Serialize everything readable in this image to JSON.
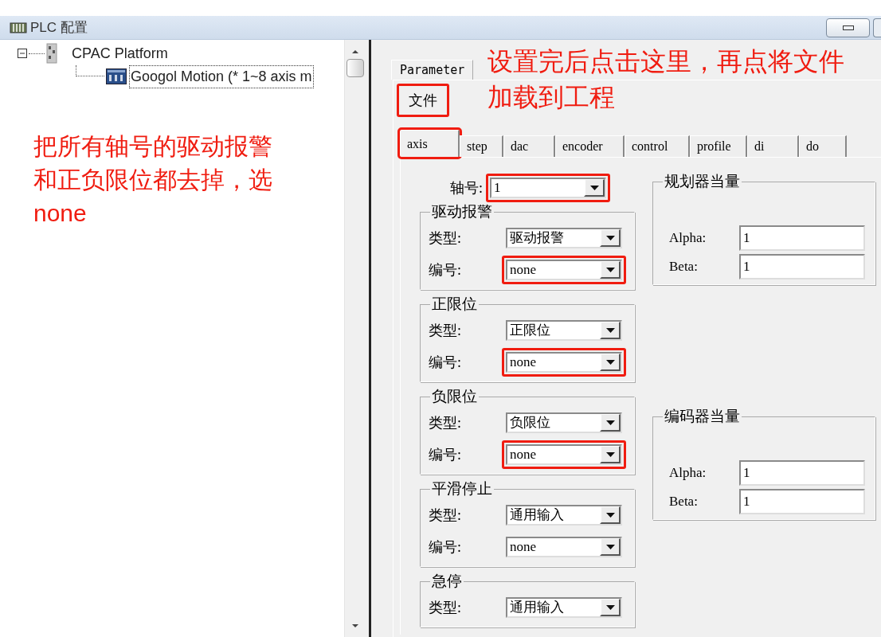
{
  "window": {
    "title": "PLC 配置"
  },
  "tree": [
    {
      "label": "CPAC Platform",
      "expanded": true,
      "children": [
        {
          "label": "Googol Motion (* 1~8 axis m",
          "selected": true
        }
      ]
    }
  ],
  "left_note": "把所有轴号的驱动报警和正负限位都去掉，选none",
  "top_note": "设置完后点击这里，再点将文件加载到工程",
  "outer_tabs": [
    {
      "label": "Parameter",
      "selected": true
    }
  ],
  "file_button": {
    "label": "文件",
    "highlighted": true
  },
  "tabs": [
    {
      "label": "axis",
      "selected": true,
      "highlighted": true
    },
    {
      "label": "step",
      "selected": false,
      "highlighted": false
    },
    {
      "label": "dac",
      "selected": false,
      "highlighted": false
    },
    {
      "label": "encoder",
      "selected": false,
      "highlighted": false
    },
    {
      "label": "control",
      "selected": false,
      "highlighted": false
    },
    {
      "label": "profile",
      "selected": false,
      "highlighted": false
    },
    {
      "label": "di",
      "selected": false,
      "highlighted": false
    },
    {
      "label": "do",
      "selected": false,
      "highlighted": false
    }
  ],
  "axis_field": {
    "label": "轴号:",
    "value": "1",
    "highlighted": true
  },
  "groups": [
    {
      "title": "驱动报警",
      "fields": [
        {
          "label": "类型:",
          "value": "驱动报警",
          "highlighted": false
        },
        {
          "label": "编号:",
          "value": "none",
          "highlighted": true
        }
      ]
    },
    {
      "title": "正限位",
      "fields": [
        {
          "label": "类型:",
          "value": "正限位",
          "highlighted": false
        },
        {
          "label": "编号:",
          "value": "none",
          "highlighted": true
        }
      ]
    },
    {
      "title": "负限位",
      "fields": [
        {
          "label": "类型:",
          "value": "负限位",
          "highlighted": false
        },
        {
          "label": "编号:",
          "value": "none",
          "highlighted": true
        }
      ]
    },
    {
      "title": "平滑停止",
      "fields": [
        {
          "label": "类型:",
          "value": "通用输入",
          "highlighted": false
        },
        {
          "label": "编号:",
          "value": "none",
          "highlighted": false
        }
      ]
    },
    {
      "title": "急停",
      "fields": [
        {
          "label": "类型:",
          "value": "通用输入",
          "highlighted": false
        }
      ]
    }
  ],
  "equivalents": [
    {
      "title": "规划器当量",
      "fields": [
        {
          "label": "Alpha:",
          "value": "1"
        },
        {
          "label": "Beta:",
          "value": "1"
        }
      ]
    },
    {
      "title": "编码器当量",
      "fields": [
        {
          "label": "Alpha:",
          "value": "1"
        },
        {
          "label": "Beta:",
          "value": "1"
        }
      ]
    }
  ]
}
